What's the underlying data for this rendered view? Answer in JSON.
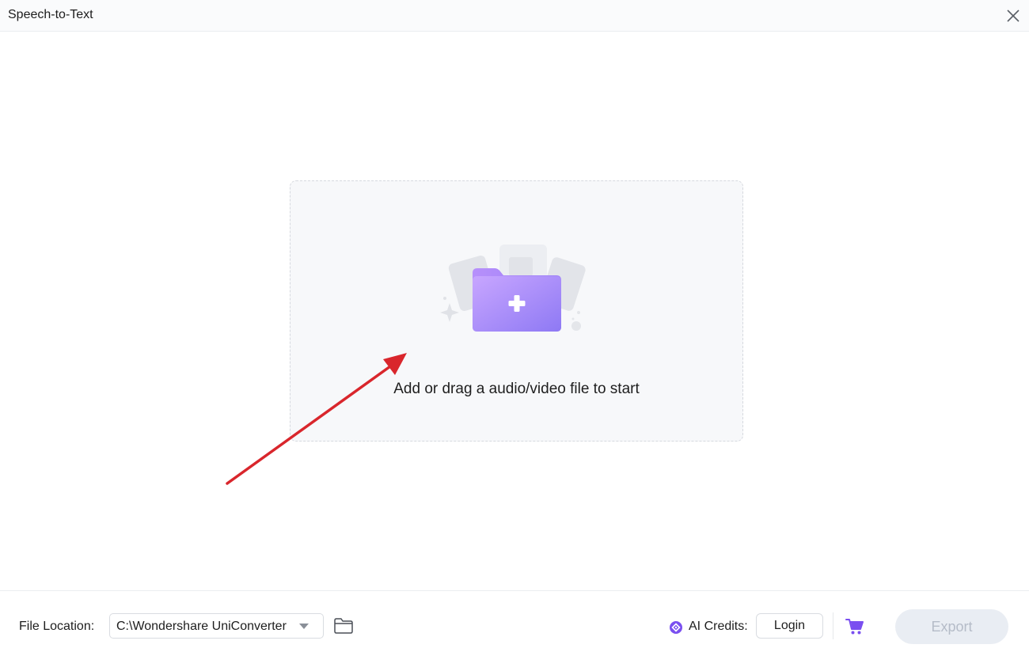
{
  "window": {
    "title": "Speech-to-Text"
  },
  "dropzone": {
    "prompt": "Add or drag a audio/video file to start"
  },
  "footer": {
    "file_location_label": "File Location:",
    "file_location_value": "C:\\Wondershare UniConverter",
    "ai_credits_label": "AI Credits:",
    "login_label": "Login",
    "export_label": "Export"
  },
  "icons": {
    "close": "close-icon",
    "dropdown": "chevron-down-icon",
    "folder": "folder-open-icon",
    "credits": "ai-credits-icon",
    "cart": "cart-icon",
    "add_folder": "add-folder-icon"
  },
  "colors": {
    "accent": "#8b6cf6",
    "export_disabled_bg": "#e9edf3",
    "export_disabled_text": "#b5bcc8",
    "annotation_arrow": "#d9262c"
  }
}
